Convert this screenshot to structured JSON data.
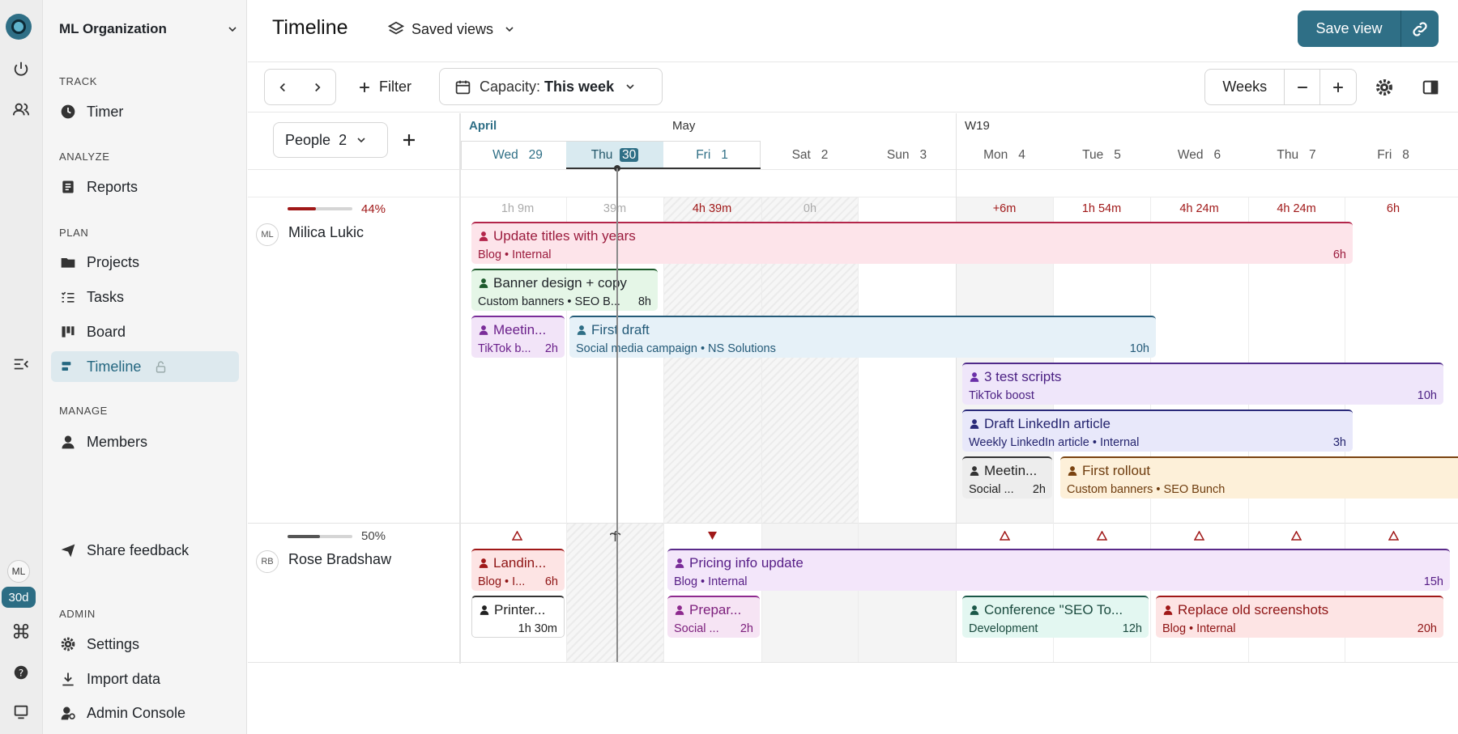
{
  "sidebar": {
    "org": "ML Organization",
    "sections": {
      "track": "TRACK",
      "analyze": "ANALYZE",
      "plan": "PLAN",
      "manage": "MANAGE",
      "admin": "ADMIN"
    },
    "items": {
      "timer": "Timer",
      "reports": "Reports",
      "projects": "Projects",
      "tasks": "Tasks",
      "board": "Board",
      "timeline": "Timeline",
      "members": "Members",
      "feedback": "Share feedback",
      "settings": "Settings",
      "import": "Import data",
      "admin_console": "Admin Console"
    }
  },
  "rail": {
    "avatar": "ML",
    "badge": "30d"
  },
  "header": {
    "title": "Timeline",
    "saved_views": "Saved views",
    "save_view": "Save view"
  },
  "toolbar": {
    "filter": "Filter",
    "capacity_label": "Capacity:",
    "capacity_value": "This week",
    "view": "Weeks",
    "people_label": "People",
    "people_count": "2"
  },
  "calendar": {
    "months": {
      "april": "April",
      "may": "May",
      "week": "W19"
    },
    "days": [
      {
        "name": "Wed",
        "num": "29"
      },
      {
        "name": "Thu",
        "num": "30"
      },
      {
        "name": "Fri",
        "num": "1"
      },
      {
        "name": "Sat",
        "num": "2"
      },
      {
        "name": "Sun",
        "num": "3"
      },
      {
        "name": "Mon",
        "num": "4"
      },
      {
        "name": "Tue",
        "num": "5"
      },
      {
        "name": "Wed",
        "num": "6"
      },
      {
        "name": "Thu",
        "num": "7"
      },
      {
        "name": "Fri",
        "num": "8"
      }
    ]
  },
  "people": [
    {
      "initials": "ML",
      "name": "Milica Lukic",
      "percent": "44%",
      "load": 0.44,
      "capacity": [
        "1h 9m",
        "39m",
        "4h 39m",
        "0h",
        "",
        "+6m",
        "1h 54m",
        "4h 24m",
        "4h 24m",
        "6h"
      ],
      "tasks": [
        {
          "title": "Update titles with years",
          "sub": "Blog • Internal",
          "hours": "6h"
        },
        {
          "title": "Banner design + copy",
          "sub": "Custom banners • SEO B...",
          "hours": "8h"
        },
        {
          "title": "Meetin...",
          "sub": "TikTok b...",
          "hours": "2h"
        },
        {
          "title": "First draft",
          "sub": "Social media campaign • NS Solutions",
          "hours": "10h"
        },
        {
          "title": "3 test scripts",
          "sub": "TikTok boost",
          "hours": "10h"
        },
        {
          "title": "Draft LinkedIn article",
          "sub": "Weekly LinkedIn article • Internal",
          "hours": "3h"
        },
        {
          "title": "Meetin...",
          "sub": "Social ...",
          "hours": "2h"
        },
        {
          "title": "First rollout",
          "sub": "Custom banners • SEO Bunch",
          "hours": ""
        }
      ]
    },
    {
      "initials": "RB",
      "name": "Rose Bradshaw",
      "percent": "50%",
      "load": 0.5,
      "tasks": [
        {
          "title": "Landin...",
          "sub": "Blog • I...",
          "hours": "6h"
        },
        {
          "title": "Printer...",
          "sub": "",
          "hours": "1h 30m"
        },
        {
          "title": "Pricing info update",
          "sub": "Blog • Internal",
          "hours": "15h"
        },
        {
          "title": "Prepar...",
          "sub": "Social ...",
          "hours": "2h"
        },
        {
          "title": "Conference \"SEO To...",
          "sub": "Development",
          "hours": "12h"
        },
        {
          "title": "Replace old screenshots",
          "sub": "Blog • Internal",
          "hours": "20h"
        }
      ]
    }
  ],
  "colors": {
    "accent": "#2f6f86",
    "over": "#a01818"
  }
}
